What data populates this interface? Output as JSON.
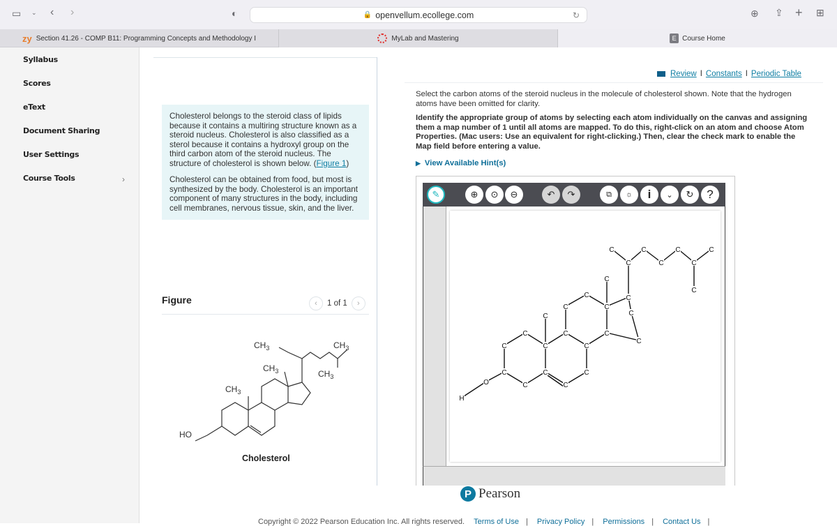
{
  "browser": {
    "url": "openvellum.ecollege.com",
    "tabs": [
      {
        "label": "Section 41.26 - COMP B11: Programming Concepts and Methodology I",
        "icon": "zy-logo"
      },
      {
        "label": "MyLab and Mastering",
        "icon": "pearson-logo"
      },
      {
        "label": "Course Home",
        "icon": "E"
      }
    ],
    "zy_logo_text": "zy",
    "tab3_badge": "E"
  },
  "sidebar": {
    "items": [
      {
        "label": "Syllabus"
      },
      {
        "label": "Scores"
      },
      {
        "label": "eText"
      },
      {
        "label": "Document Sharing"
      },
      {
        "label": "User Settings"
      },
      {
        "label": "Course Tools",
        "has_submenu": true
      }
    ]
  },
  "intro": {
    "paragraph1": "Cholesterol belongs to the steroid class of lipids because it contains a multiring structure known as a steroid nucleus. Cholesterol is also classified as a sterol because it contains a hydroxyl group on the third carbon atom of the steroid nucleus. The structure of cholesterol is shown below. (",
    "figure_link": "Figure 1",
    "paragraph1_end": ")",
    "paragraph2": "Cholesterol can be obtained from food, but most is synthesized by the body. Cholesterol is an important component of many structures in the body, including cell membranes, nervous tissue, skin, and the liver."
  },
  "figure": {
    "title": "Figure",
    "pager": "1 of 1",
    "caption": "Cholesterol",
    "labels": {
      "ch3_a": "CH3",
      "ch3_b": "CH3",
      "ch3_c": "CH3",
      "ch3_d": "CH3",
      "ch3_e": "CH3",
      "ho": "HO"
    }
  },
  "resources": {
    "review": "Review",
    "constants": "Constants",
    "periodic_table": "Periodic Table",
    "separator": "I"
  },
  "question": {
    "prompt": "Select the carbon atoms of the steroid nucleus in the molecule of cholesterol shown. Note that the hydrogen atoms have been omitted for clarity.",
    "instructions": "Identify the appropriate group of atoms by selecting each atom individually on the canvas and assigning them a map number of 1 until all atoms are mapped. To do this, right-click on an atom and choose Atom Properties.  (Mac users: Use an equivalent for right-clicking.) Then, clear the check mark to enable the Map field before entering a value.",
    "hint_label": "View Available Hint(s)"
  },
  "editor": {
    "tools": [
      "draw",
      "zoom-in",
      "zoom-fit",
      "zoom-out",
      "undo",
      "redo",
      "copy-template",
      "hint-bulb",
      "info",
      "more",
      "reset",
      "help"
    ],
    "atom_label": "C",
    "oxygen_label": "O",
    "hydrogen_label": "H"
  },
  "brand": {
    "name": "Pearson",
    "logo_letter": "P"
  },
  "footer": {
    "copyright": "Copyright © 2022 Pearson Education Inc. All rights reserved.",
    "links": [
      "Terms of Use",
      "Privacy Policy",
      "Permissions",
      "Contact Us"
    ]
  },
  "colors": {
    "accent": "#0f7ea3",
    "info_bg": "#e7f5f7",
    "toolbar_dark": "#4b4c52",
    "pen_teal": "#1fb8bf",
    "pearson_blue": "#0d7aa0"
  }
}
